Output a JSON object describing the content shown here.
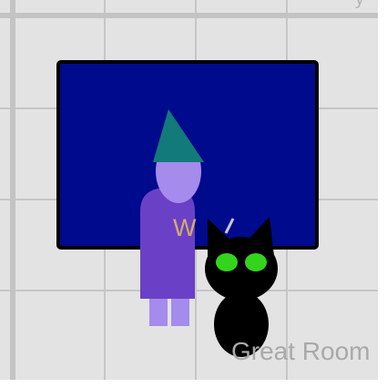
{
  "room": {
    "name": "Great Room"
  },
  "wizard": {
    "robe_letter": "W",
    "hat_color": "#127a79",
    "skin_color": "#a48bec",
    "robe_color": "#6a40c7",
    "legs_color": "#a48bec",
    "letter_color": "#d3ad6a"
  },
  "cat": {
    "body_color": "#000000",
    "eye_color": "#33d41c",
    "whisker_color": "#c8c8d8"
  },
  "colors": {
    "floor": "#e3e3e3",
    "grid": "#c6c6c6",
    "tv_screen": "#000a8c",
    "tv_frame": "#000000",
    "room_label": "#a9a9a9"
  },
  "icons": {
    "corner": "partial-glyph"
  }
}
